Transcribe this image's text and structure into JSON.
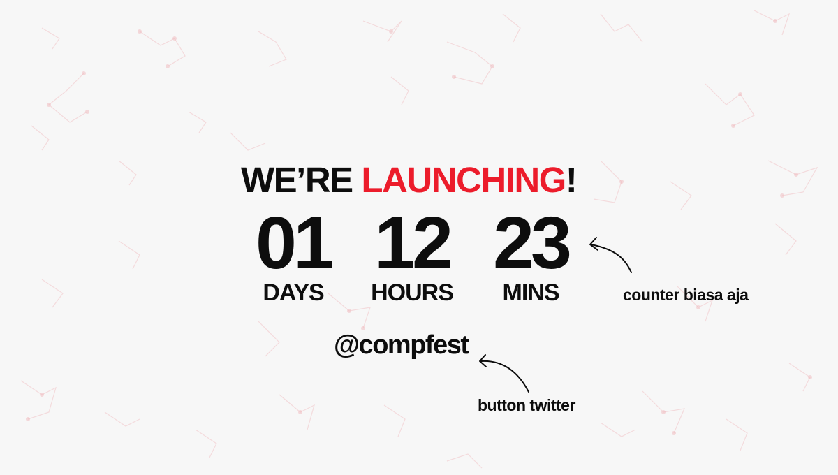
{
  "headline": {
    "prefix": "WE’RE ",
    "highlight": "LAUNCHING",
    "suffix": "!"
  },
  "countdown": [
    {
      "value": "01",
      "unit": "DAYS"
    },
    {
      "value": "12",
      "unit": "HOURS"
    },
    {
      "value": "23",
      "unit": "MINS"
    }
  ],
  "twitter_handle": "@compfest",
  "annotations": {
    "counter_note": "counter biasa aja",
    "button_note": "button twitter"
  },
  "colors": {
    "accent": "#ec1c2b",
    "text": "#0d0d0d",
    "background": "#f7f7f7",
    "pattern": "#e8a8ae"
  }
}
